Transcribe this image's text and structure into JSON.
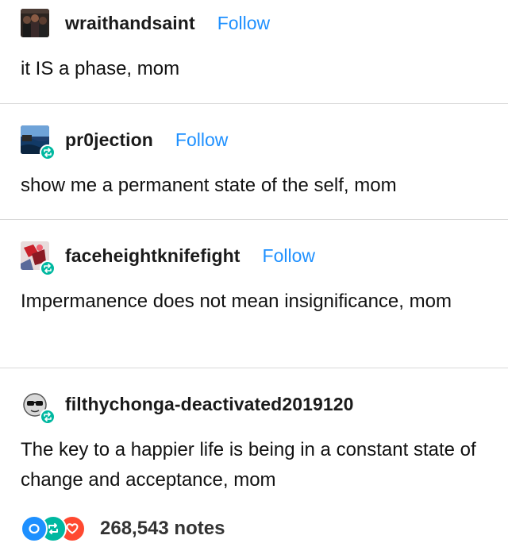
{
  "posts": [
    {
      "username": "wraithandsaint",
      "follow_label": "Follow",
      "text": "it IS a phase, mom",
      "avatar_icon": "group-photo-avatar",
      "reblog": false
    },
    {
      "username": "pr0jection",
      "follow_label": "Follow",
      "text": "show me a permanent state of the self, mom",
      "avatar_icon": "ocean-landscape-avatar",
      "reblog": true
    },
    {
      "username": "faceheightknifefight",
      "follow_label": "Follow",
      "text": "Impermanence does not mean insignificance, mom",
      "avatar_icon": "red-art-avatar",
      "reblog": true
    },
    {
      "username": "filthychonga-deactivated2019120",
      "follow_label": "",
      "text": "The key to a happier life is being in a constant state of change and acceptance, mom",
      "avatar_icon": "sunglasses-cat-avatar",
      "reblog": true
    }
  ],
  "notes": {
    "count_label": "268,543 notes",
    "icons": [
      "comment-icon",
      "reblog-icon",
      "heart-icon"
    ]
  },
  "colors": {
    "follow": "#1e90ff",
    "reblog": "#00b8a0",
    "comment": "#1e90ff",
    "heart": "#ff4930",
    "divider": "#d9d9d9"
  }
}
